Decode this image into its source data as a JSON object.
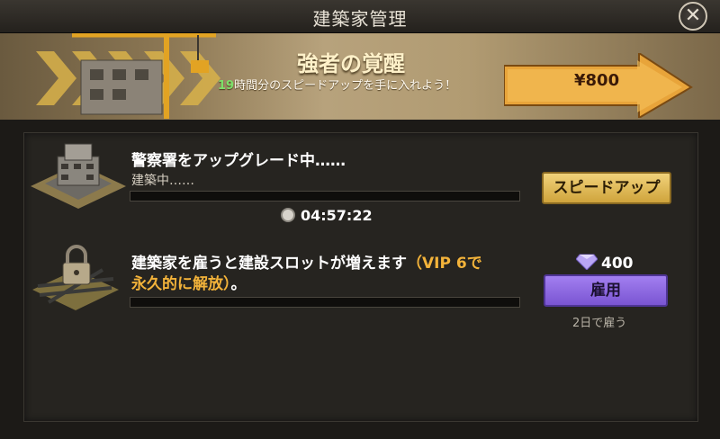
{
  "header": {
    "title": "建築家管理"
  },
  "banner": {
    "heading": "強者の覚醒",
    "subtitle_hours": "19",
    "subtitle_rest": "時間分のスピードアップを手に入れよう！",
    "price": "¥800"
  },
  "queue": {
    "title": "警察署をアップグレード中……",
    "status": "建築中……",
    "timer": "04:57:22",
    "speedup_label": "スピードアップ"
  },
  "hire": {
    "text_main": "建築家を雇うと建設スロットが増えます",
    "text_vip_line1": "（VIP 6で",
    "text_vip_line2": "永久的に解放）",
    "text_end": "。",
    "gem_cost": "400",
    "hire_label": "雇用",
    "duration_note": "2日で雇う"
  },
  "colors": {
    "hire_button": "#8f6be6",
    "speed_button": "#e4bd5a",
    "vip_text": "#f3b33a"
  },
  "icons": [
    "close-icon",
    "stopwatch-icon",
    "gem-icon",
    "lock-icon",
    "crane-icon"
  ]
}
